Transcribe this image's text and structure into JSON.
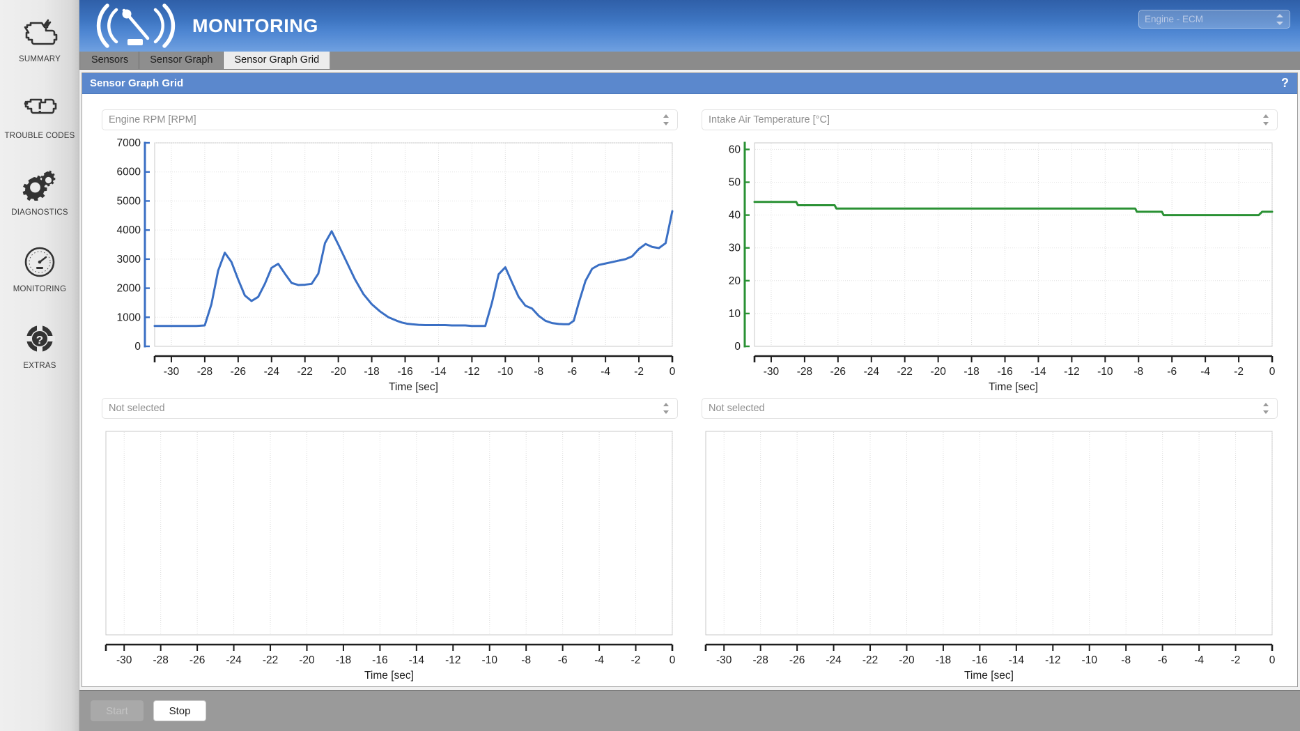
{
  "sidebar": {
    "items": [
      {
        "label": "SUMMARY",
        "icon": "engine-lightning-icon"
      },
      {
        "label": "TROUBLE CODES",
        "icon": "engine-warning-icon"
      },
      {
        "label": "DIAGNOSTICS",
        "icon": "gears-icon"
      },
      {
        "label": "MONITORING",
        "icon": "gauge-icon"
      },
      {
        "label": "EXTRAS",
        "icon": "help-wheel-icon"
      }
    ]
  },
  "header": {
    "title": "MONITORING",
    "logo_icon": "speedometer-logo-icon",
    "ecu_select": {
      "value": "Engine - ECM",
      "stepper_icon": "stepper-up-down-icon"
    }
  },
  "tabs": [
    {
      "label": "Sensors",
      "active": false
    },
    {
      "label": "Sensor Graph",
      "active": false
    },
    {
      "label": "Sensor Graph Grid",
      "active": true
    }
  ],
  "panel": {
    "title": "Sensor Graph Grid",
    "help_label": "?",
    "help_icon": "question-mark-icon"
  },
  "footer": {
    "start_label": "Start",
    "start_enabled": false,
    "stop_label": "Stop",
    "stop_enabled": true
  },
  "colors": {
    "accent_blue": "#5b88cd",
    "header_blue": "#3d74c0",
    "rpm_series": "#3a6fc4",
    "temp_series": "#2a9134",
    "sidebar_bg": "#eaeaea",
    "tabbar_bg": "#8b8b8b",
    "bottombar_bg": "#9a9a9a"
  },
  "chart_data": [
    {
      "id": "chart-rpm",
      "type": "line",
      "title": "Engine RPM [RPM]",
      "selected_sensor": "Engine RPM [RPM]",
      "xlabel": "Time [sec]",
      "ylabel": "",
      "xlim": [
        -31,
        0
      ],
      "ylim": [
        0,
        7000
      ],
      "xticks": [
        -30,
        -28,
        -26,
        -24,
        -22,
        -20,
        -18,
        -16,
        -14,
        -12,
        -10,
        -8,
        -6,
        -4,
        -2,
        0
      ],
      "yticks": [
        0,
        1000,
        2000,
        3000,
        4000,
        5000,
        6000,
        7000
      ],
      "grid": true,
      "axis_color": "#3a6fc4",
      "series": [
        {
          "name": "Engine RPM",
          "color": "#3a6fc4",
          "x": [
            -31,
            -30,
            -29,
            -28.5,
            -28,
            -27.6,
            -27.2,
            -26.8,
            -26.4,
            -26,
            -25.6,
            -25.2,
            -24.8,
            -24.4,
            -24,
            -23.6,
            -23.2,
            -22.8,
            -22.4,
            -22,
            -21.6,
            -21.2,
            -20.8,
            -20.4,
            -20,
            -19.5,
            -19,
            -18.5,
            -18,
            -17.5,
            -17,
            -16.5,
            -16.2,
            -15.9,
            -15.6,
            -15.2,
            -14.8,
            -14.4,
            -14,
            -13.6,
            -13.2,
            -12.8,
            -12.4,
            -12,
            -11.6,
            -11.2,
            -10.8,
            -10.4,
            -10,
            -9.6,
            -9.2,
            -8.8,
            -8.4,
            -8,
            -7.6,
            -7.2,
            -6.8,
            -6.5,
            -6.2,
            -5.9,
            -5.6,
            -5.2,
            -4.8,
            -4.4,
            -4,
            -3.6,
            -3.2,
            -2.8,
            -2.4,
            -2,
            -1.6,
            -1.2,
            -0.8,
            -0.4,
            0
          ],
          "y": [
            700,
            700,
            700,
            700,
            720,
            1450,
            2600,
            3220,
            2900,
            2300,
            1750,
            1560,
            1700,
            2150,
            2700,
            2840,
            2500,
            2180,
            2110,
            2120,
            2150,
            2500,
            3550,
            3960,
            3500,
            2900,
            2300,
            1800,
            1450,
            1200,
            1000,
            880,
            820,
            780,
            760,
            740,
            730,
            730,
            730,
            730,
            720,
            720,
            720,
            700,
            700,
            700,
            1500,
            2480,
            2720,
            2200,
            1700,
            1400,
            1300,
            1050,
            880,
            800,
            770,
            760,
            760,
            880,
            1500,
            2250,
            2670,
            2800,
            2850,
            2900,
            2950,
            3000,
            3100,
            3350,
            3520,
            3420,
            3380,
            3550,
            4650
          ]
        }
      ]
    },
    {
      "id": "chart-iat",
      "type": "line",
      "title": "Intake Air Temperature [°C]",
      "selected_sensor": "Intake Air Temperature [°C]",
      "xlabel": "Time [sec]",
      "ylabel": "",
      "xlim": [
        -31,
        0
      ],
      "ylim": [
        0,
        62
      ],
      "xticks": [
        -30,
        -28,
        -26,
        -24,
        -22,
        -20,
        -18,
        -16,
        -14,
        -12,
        -10,
        -8,
        -6,
        -4,
        -2,
        0
      ],
      "yticks": [
        0,
        10,
        20,
        30,
        40,
        50,
        60
      ],
      "grid": true,
      "axis_color": "#2a9134",
      "series": [
        {
          "name": "Intake Air Temperature",
          "color": "#2a9134",
          "x": [
            -31,
            -28.5,
            -28.4,
            -26.2,
            -26.1,
            -8.2,
            -8.1,
            -6.6,
            -6.5,
            -0.8,
            -0.6,
            0
          ],
          "y": [
            44,
            44,
            43,
            43,
            42,
            42,
            41,
            41,
            40,
            40,
            41,
            41
          ]
        }
      ]
    },
    {
      "id": "chart-empty-1",
      "type": "line",
      "title": "Not selected",
      "selected_sensor": "Not selected",
      "xlabel": "Time [sec]",
      "ylabel": "",
      "xlim": [
        -31,
        0
      ],
      "ylim": [
        0,
        1
      ],
      "xticks": [
        -30,
        -28,
        -26,
        -24,
        -22,
        -20,
        -18,
        -16,
        -14,
        -12,
        -10,
        -8,
        -6,
        -4,
        -2,
        0
      ],
      "yticks": [],
      "grid": true,
      "axis_color": "#c8c8c8",
      "series": []
    },
    {
      "id": "chart-empty-2",
      "type": "line",
      "title": "Not selected",
      "selected_sensor": "Not selected",
      "xlabel": "Time [sec]",
      "ylabel": "",
      "xlim": [
        -31,
        0
      ],
      "ylim": [
        0,
        1
      ],
      "xticks": [
        -30,
        -28,
        -26,
        -24,
        -22,
        -20,
        -18,
        -16,
        -14,
        -12,
        -10,
        -8,
        -6,
        -4,
        -2,
        0
      ],
      "yticks": [],
      "grid": true,
      "axis_color": "#c8c8c8",
      "series": []
    }
  ]
}
